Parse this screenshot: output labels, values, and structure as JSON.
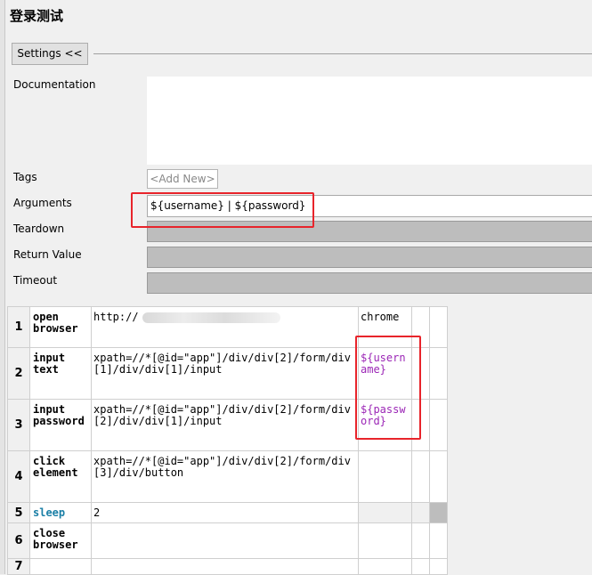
{
  "title": "登录测试",
  "settings_button": "Settings <<",
  "labels": {
    "documentation": "Documentation",
    "tags": "Tags",
    "arguments": "Arguments",
    "teardown": "Teardown",
    "return_value": "Return Value",
    "timeout": "Timeout"
  },
  "tags": {
    "add_new": "<Add New>"
  },
  "arguments_value": "${username} | ${password}",
  "steps": [
    {
      "row": "1",
      "keyword": "open browser",
      "arg1": "http://",
      "arg2": "chrome"
    },
    {
      "row": "2",
      "keyword": "input text",
      "arg1": "xpath=//*[@id=\"app\"]/div/div[2]/form/div[1]/div/div[1]/input",
      "arg2": "${username}"
    },
    {
      "row": "3",
      "keyword": "input password",
      "arg1": "xpath=//*[@id=\"app\"]/div/div[2]/form/div[2]/div/div[1]/input",
      "arg2": "${password}"
    },
    {
      "row": "4",
      "keyword": "click element",
      "arg1": "xpath=//*[@id=\"app\"]/div/div[2]/form/div[3]/div/button",
      "arg2": ""
    },
    {
      "row": "5",
      "keyword": "sleep",
      "arg1": "2",
      "arg2": ""
    },
    {
      "row": "6",
      "keyword": "close browser",
      "arg1": "",
      "arg2": ""
    },
    {
      "row": "7",
      "keyword": "",
      "arg1": "",
      "arg2": ""
    }
  ],
  "colors": {
    "highlight": "#e8242b",
    "variable": "#9b26b6",
    "builtin_keyword": "#1a7fa6"
  }
}
